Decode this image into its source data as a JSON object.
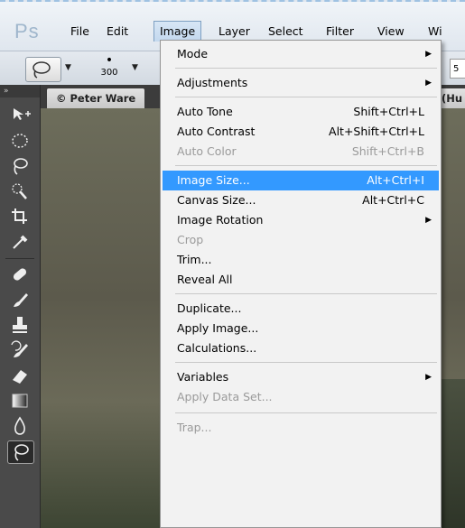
{
  "app": {
    "logo": "Ps"
  },
  "menubar": {
    "items": [
      "File",
      "Edit",
      "Image",
      "Layer",
      "Select",
      "Filter",
      "View",
      "Wi"
    ]
  },
  "options": {
    "brush_size": "300",
    "right_value": "5"
  },
  "document": {
    "tab_title": "© Peter Ware",
    "right_tab": "(Hu"
  },
  "image_menu": {
    "items": [
      {
        "label": "Mode",
        "shortcut": "",
        "submenu": true,
        "disabled": false
      },
      {
        "label": "Adjustments",
        "shortcut": "",
        "submenu": true,
        "disabled": false
      },
      {
        "label": "Auto Tone",
        "shortcut": "Shift+Ctrl+L",
        "submenu": false,
        "disabled": false
      },
      {
        "label": "Auto Contrast",
        "shortcut": "Alt+Shift+Ctrl+L",
        "submenu": false,
        "disabled": false
      },
      {
        "label": "Auto Color",
        "shortcut": "Shift+Ctrl+B",
        "submenu": false,
        "disabled": true
      },
      {
        "label": "Image Size...",
        "shortcut": "Alt+Ctrl+I",
        "submenu": false,
        "disabled": false,
        "highlighted": true
      },
      {
        "label": "Canvas Size...",
        "shortcut": "Alt+Ctrl+C",
        "submenu": false,
        "disabled": false
      },
      {
        "label": "Image Rotation",
        "shortcut": "",
        "submenu": true,
        "disabled": false
      },
      {
        "label": "Crop",
        "shortcut": "",
        "submenu": false,
        "disabled": true
      },
      {
        "label": "Trim...",
        "shortcut": "",
        "submenu": false,
        "disabled": false
      },
      {
        "label": "Reveal All",
        "shortcut": "",
        "submenu": false,
        "disabled": false
      },
      {
        "label": "Duplicate...",
        "shortcut": "",
        "submenu": false,
        "disabled": false
      },
      {
        "label": "Apply Image...",
        "shortcut": "",
        "submenu": false,
        "disabled": false
      },
      {
        "label": "Calculations...",
        "shortcut": "",
        "submenu": false,
        "disabled": false
      },
      {
        "label": "Variables",
        "shortcut": "",
        "submenu": true,
        "disabled": false
      },
      {
        "label": "Apply Data Set...",
        "shortcut": "",
        "submenu": false,
        "disabled": true
      },
      {
        "label": "Trap...",
        "shortcut": "",
        "submenu": false,
        "disabled": true
      }
    ]
  },
  "colors": {
    "highlight": "#3399ff",
    "disabled_text": "#9a9a9a",
    "toolbar_bg": "#4a4a4a"
  },
  "toolbar_icons": [
    "move-icon",
    "elliptical-marquee-icon",
    "lasso-icon",
    "quick-selection-icon",
    "crop-icon",
    "eyedropper-icon",
    "healing-brush-icon",
    "brush-icon",
    "clone-stamp-icon",
    "history-brush-icon",
    "eraser-icon",
    "gradient-icon",
    "blur-icon",
    "lasso-selected-icon"
  ]
}
